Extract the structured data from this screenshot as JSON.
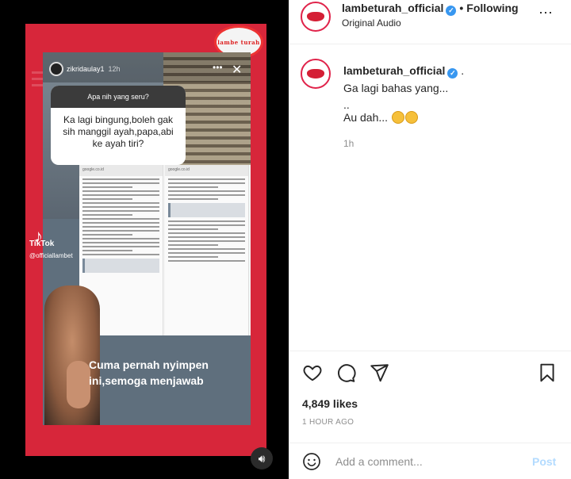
{
  "media": {
    "story_username": "zikridaulay1",
    "story_time": "12h",
    "question_header": "Apa nih yang seru?",
    "question_text": "Ka lagi bingung,boleh gak sih manggil ayah,papa,abi ke ayah tiri?",
    "url_left": "google.co.id",
    "url_right": "google.co.id",
    "caption_line1": "Cuma pernah nyimpen",
    "caption_line2": "ini,semoga menjawab",
    "tiktok_label": "TikTok",
    "tiktok_handle": "@officiallambet",
    "watermark_text": "lambe turah",
    "icons": {
      "sound": "speaker-icon",
      "close": "close-icon",
      "more": "more-icon",
      "tiktok": "tiktok-icon"
    }
  },
  "header": {
    "username": "lambeturah_official",
    "separator": "•",
    "follow_status": "Following",
    "audio": "Original Audio",
    "more_icon": "⋯"
  },
  "post": {
    "username": "lambeturah_official",
    "username_suffix": ".",
    "caption_lines": [
      "Ga lagi bahas yang...",
      "..",
      "Au dah..."
    ],
    "time": "1h"
  },
  "actions": {
    "likes": "4,849 likes",
    "posted_ago": "1 HOUR AGO"
  },
  "comment": {
    "placeholder": "Add a comment...",
    "post_label": "Post"
  },
  "colors": {
    "accent_blue": "#3897f0",
    "post_disabled": "#b3dbff",
    "frame_red": "#d7263a"
  }
}
